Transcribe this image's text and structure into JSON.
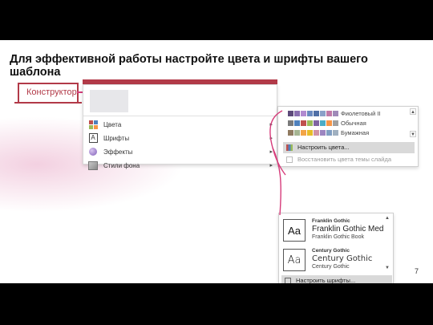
{
  "slide": {
    "title": "Для эффективной работы настройте цвета и шрифты вашего шаблона",
    "page_number": "7"
  },
  "tab": {
    "label": "Конструктор"
  },
  "menu": {
    "items": [
      {
        "label": "Цвета",
        "icon": "color-swatch-icon"
      },
      {
        "label": "Шрифты",
        "icon": "font-icon"
      },
      {
        "label": "Эффекты",
        "icon": "effects-icon"
      },
      {
        "label": "Стили фона",
        "icon": "background-styles-icon"
      }
    ],
    "submenu_arrow": "▸"
  },
  "colors_panel": {
    "schemes": [
      {
        "name": "Фиолетовый II",
        "colors": [
          "#5d4a7a",
          "#8a6fb0",
          "#b18ad0",
          "#6a8ac0",
          "#4f6fa6",
          "#8aa0c8",
          "#c07aa8",
          "#9f8ab8"
        ]
      },
      {
        "name": "Обычная",
        "colors": [
          "#7a7a7a",
          "#4f81bd",
          "#c0504d",
          "#9bbb59",
          "#8064a2",
          "#4bacc6",
          "#f79646",
          "#a0a0a0"
        ]
      },
      {
        "name": "Бумажная",
        "colors": [
          "#8f7a60",
          "#a5b592",
          "#f3a447",
          "#e7bc29",
          "#d092a7",
          "#9c85c0",
          "#809ec2",
          "#a0b0c0"
        ]
      }
    ],
    "customize_label": "Настроить цвета...",
    "restore_label": "Восстановить цвета темы слайда"
  },
  "fonts_panel": {
    "fonts": [
      {
        "preview": "Aa",
        "heading": "Franklin Gothic",
        "major": "Franklin Gothic Med",
        "minor": "Franklin Gothic Book"
      },
      {
        "preview": "Aa",
        "heading": "Century Gothic",
        "major": "Century Gothic",
        "minor": "Century Gothic"
      }
    ],
    "customize_label": "Настроить шрифты..."
  },
  "colors": {
    "accent": "#b23a48",
    "connector": "#d63b7a"
  }
}
